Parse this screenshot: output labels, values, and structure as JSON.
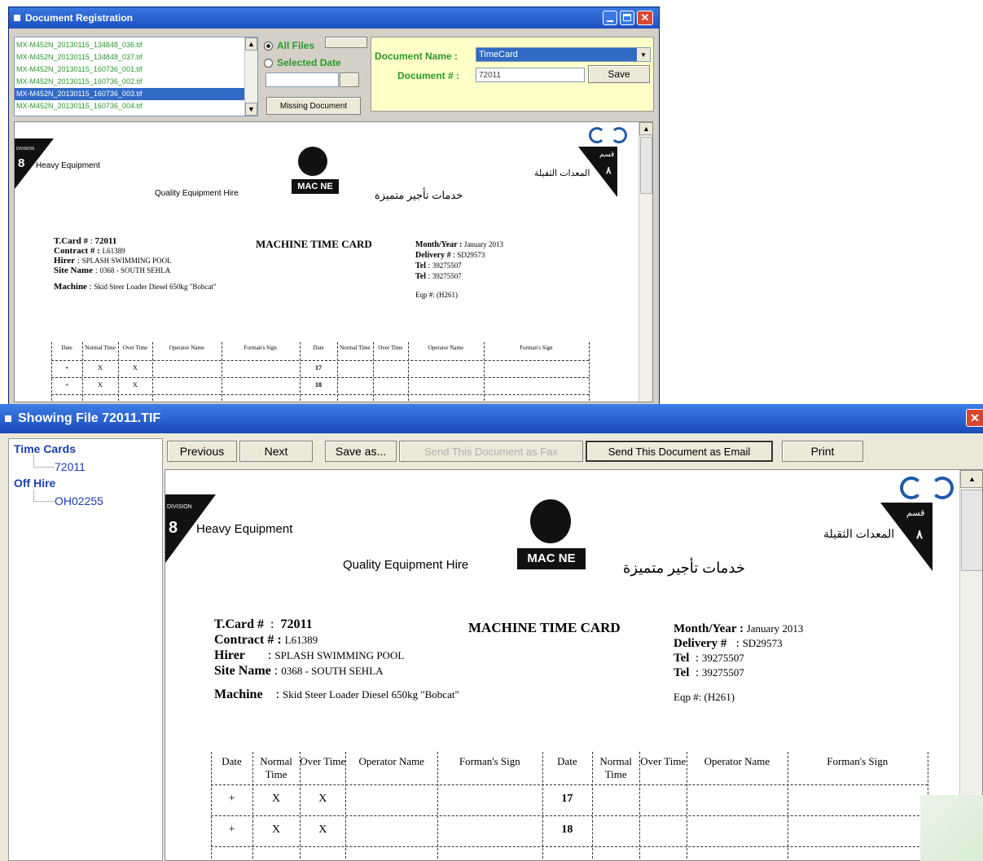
{
  "reg_window": {
    "title": "Document Registration",
    "files": [
      "MX-M452N_20130115_134848_036.tif",
      "MX-M452N_20130115_134848_037.tif",
      "MX-M452N_20130115_160736_001.tif",
      "MX-M452N_20130115_160736_002.tif",
      "MX-M452N_20130115_160736_003.tif",
      "MX-M452N_20130115_160736_004.tif"
    ],
    "selected_index": 4,
    "all_files_label": "All Files",
    "selected_date_label": "Selected Date",
    "date_value": "",
    "missing_doc_button": "Missing Document",
    "doc_name_label": "Document Name :",
    "doc_name_value": "TimeCard",
    "doc_num_label": "Document # :",
    "doc_num_value": "72011",
    "save_button": "Save"
  },
  "timecard": {
    "division_num": "8",
    "division_label": "DIVISION",
    "division_name": "Heavy Equipment",
    "arabic_division": "المعدات الثقيلة",
    "arabic_qism": "قسم",
    "arabic_num": "٨",
    "tagline": "Quality Equipment Hire",
    "logo": "MAC NE",
    "arabic_tagline": "خدمات تأجير متميزة",
    "card_title": "MACHINE TIME CARD",
    "tcard_label": "T.Card #",
    "tcard_value": "72011",
    "contract_label": "Contract # :",
    "contract_value": "L61389",
    "hirer_label": "Hirer",
    "hirer_value": "SPLASH SWIMMING POOL",
    "site_label": "Site Name",
    "site_value": "0368 - SOUTH SEHLA",
    "machine_label": "Machine",
    "machine_value": "Skid Steer Loader Diesel 650kg \"Bobcat\"",
    "month_label": "Month/Year :",
    "month_value": "January 2013",
    "delivery_label": "Delivery #",
    "delivery_value": "SD29573",
    "tel_label": "Tel",
    "tel1": "39275507",
    "tel2": "39275507",
    "eqp": "Eqp #: (H261)",
    "headers_left": [
      "Date",
      "Normal Time",
      "Over Time",
      "Operator Name",
      "Forman's Sign"
    ],
    "headers_right": [
      "Date",
      "Normal Time",
      "Over Time",
      "Operator Name",
      "Forman's Sign"
    ],
    "rows": [
      {
        "date": "+",
        "normal": "X",
        "over": "X",
        "date2": "17"
      },
      {
        "date": "+",
        "normal": "X",
        "over": "X",
        "date2": "18"
      }
    ]
  },
  "viewer_window": {
    "title": "Showing File 72011.TIF",
    "tree": {
      "group1": "Time Cards",
      "item1": "72011",
      "group2": "Off Hire",
      "item2": "OH02255"
    },
    "buttons": {
      "previous": "Previous",
      "next": "Next",
      "save_as": "Save as...",
      "send_fax": "Send This Document as Fax",
      "send_email": "Send This Document as Email",
      "print": "Print"
    }
  }
}
